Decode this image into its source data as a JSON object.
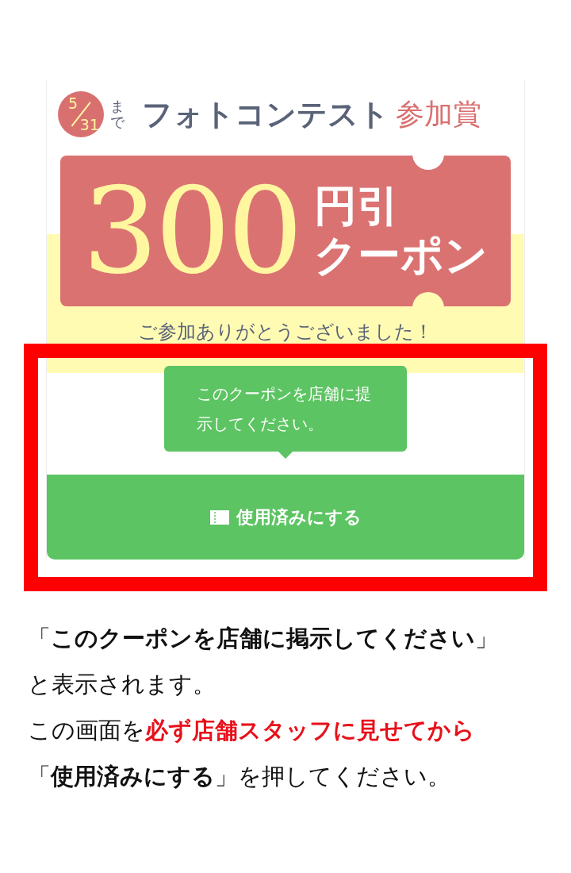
{
  "coupon": {
    "deadline_month": "5",
    "deadline_day": "31",
    "deadline_suffix": "まで",
    "title": "フォトコンテスト",
    "title_accent": "参加賞",
    "amount": "300",
    "unit": "円引",
    "label": "クーポン",
    "thanks": "ご参加ありがとうございました！"
  },
  "tooltip": {
    "text": "このクーポンを店舗に提示してください。"
  },
  "button": {
    "label": "使用済みにする"
  },
  "notes": [
    {
      "segments": [
        {
          "kind": "plain",
          "text": "「**このクーポンを店舗に掲示してください**」と表示されます。"
        }
      ]
    },
    {
      "segments": [
        {
          "kind": "plain",
          "text": "この画面を"
        },
        {
          "kind": "alert",
          "text": "**必ず店舗スタッフに見せてから**"
        },
        {
          "kind": "plain",
          "text": "「**使用済みにする**」を押してください。"
        }
      ]
    }
  ]
}
